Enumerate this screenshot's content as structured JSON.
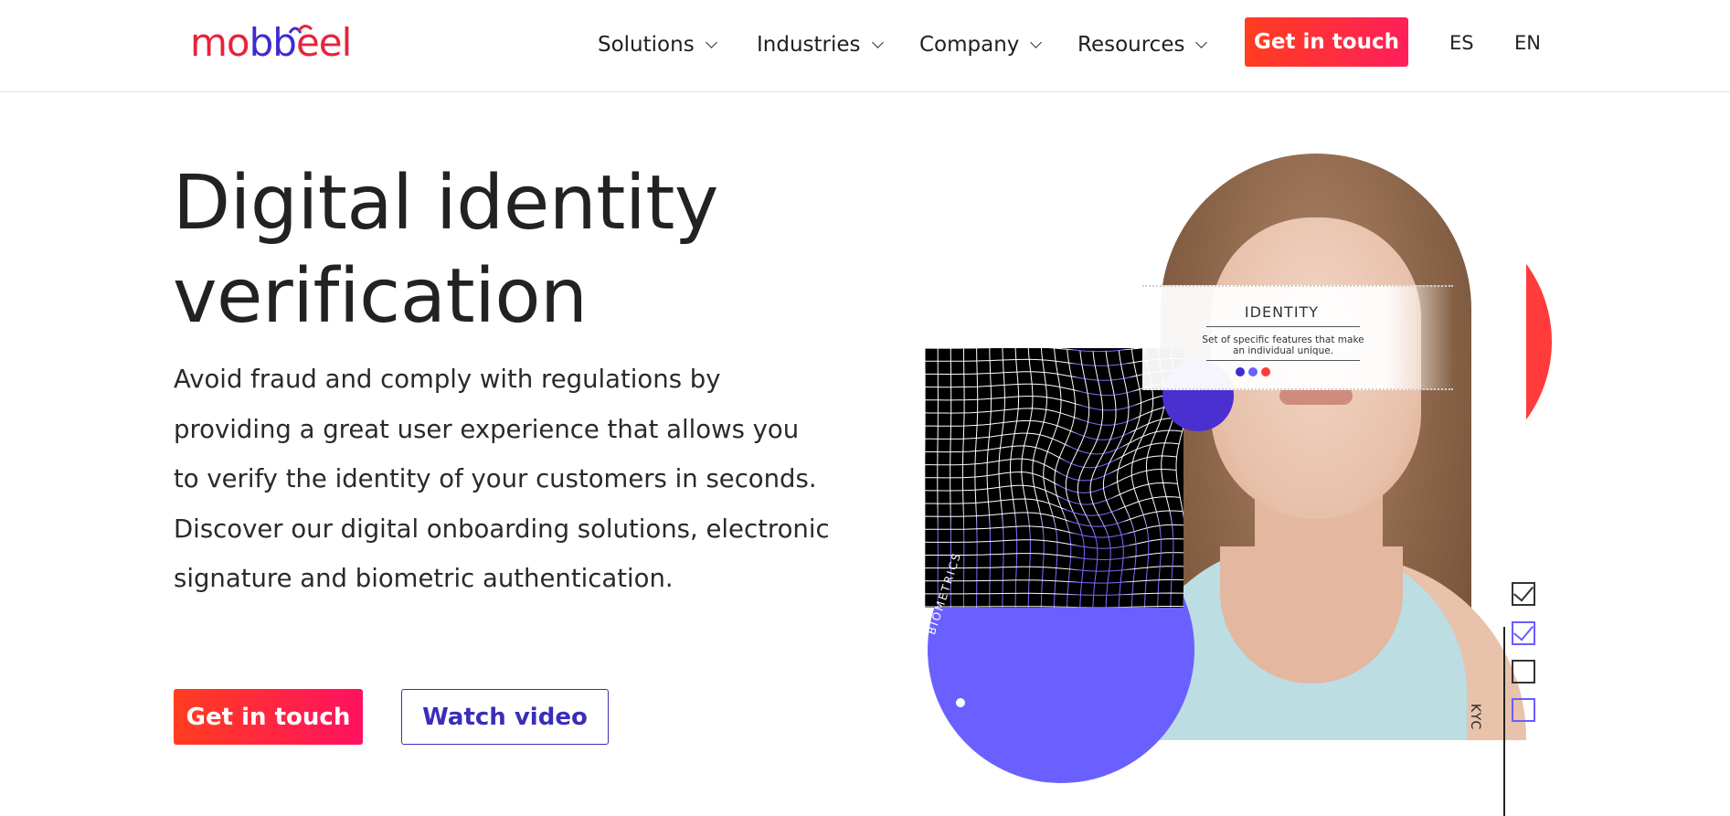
{
  "header": {
    "logo": {
      "part1": "mo",
      "part2": "bb",
      "part3": "eel",
      "brand_red": "#e8233a",
      "brand_purple": "#3e2bd1"
    },
    "nav": [
      {
        "label": "Solutions",
        "icon": "chevron-down-icon"
      },
      {
        "label": "Industries",
        "icon": "chevron-down-icon"
      },
      {
        "label": "Company",
        "icon": "chevron-down-icon"
      },
      {
        "label": "Resources",
        "icon": "chevron-down-icon"
      }
    ],
    "cta_label": "Get in touch",
    "languages": [
      "ES",
      "EN"
    ]
  },
  "hero": {
    "title_line1": "Digital identity",
    "title_line2": "verification",
    "description": "Avoid fraud and comply with regulations by providing a great user experience that allows you to verify the identity of your customers in seconds. Discover our digital onboarding solutions, electronic signature and biometric authentication.",
    "primary_button": "Get in touch",
    "secondary_button": "Watch video"
  },
  "illustration": {
    "id_card_title": "IDENTITY",
    "id_card_text": "Set of specific features that make an individual unique.",
    "biometrics_label": "BIOMETRICS",
    "kyc_label": "KYC",
    "colors": {
      "accent_red": "#ff3b3b",
      "accent_purple": "#6a60ff",
      "deep_purple": "#4a2fd1",
      "cta_gradient_start": "#ff3d1f",
      "cta_gradient_end": "#ff1160"
    }
  }
}
